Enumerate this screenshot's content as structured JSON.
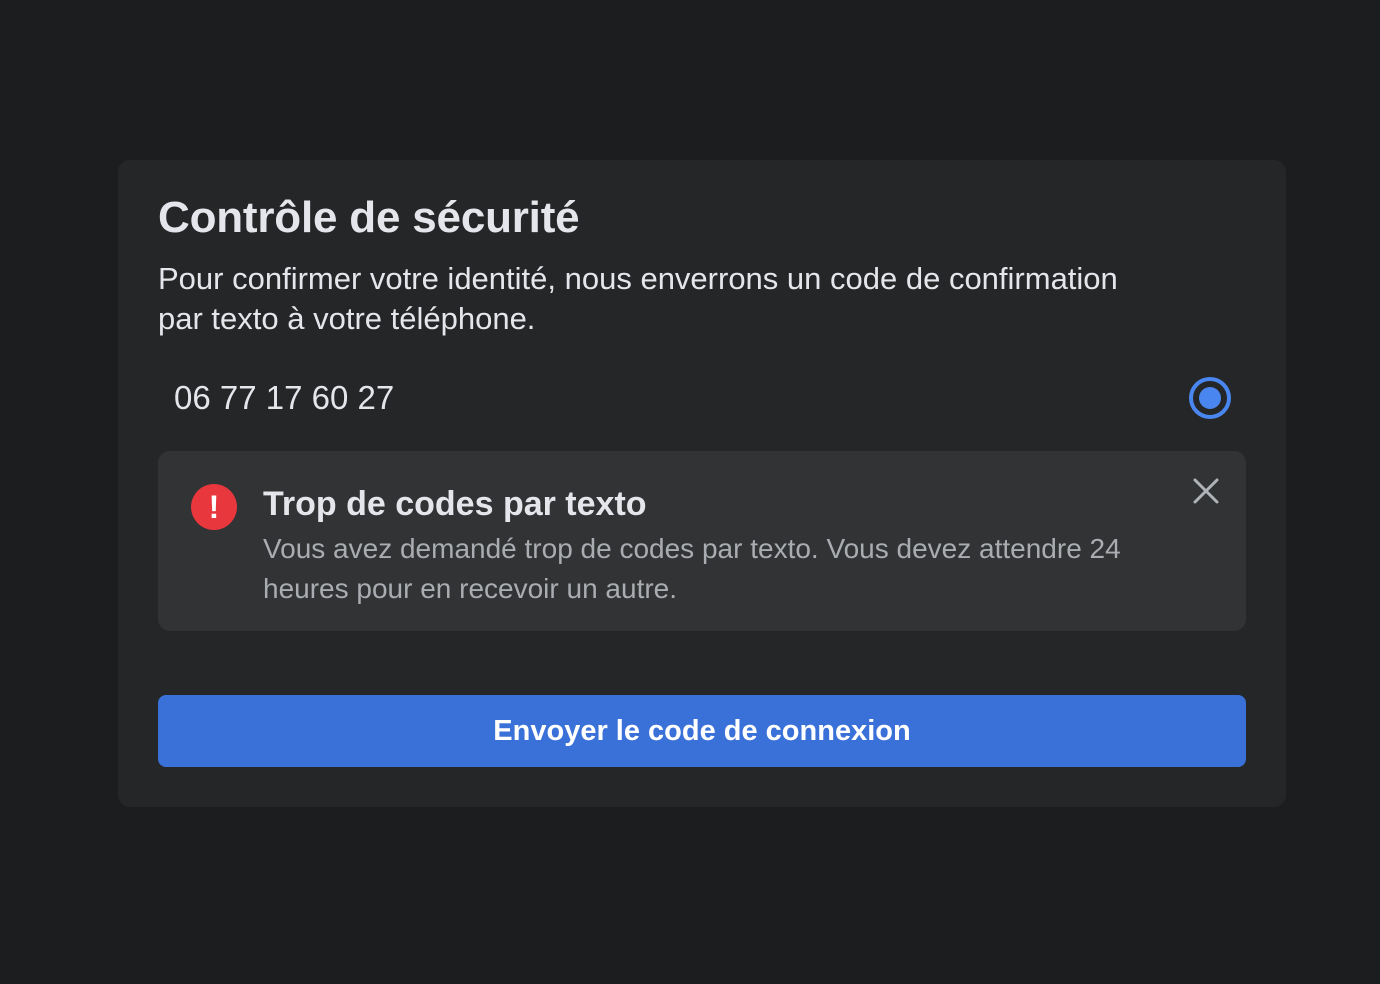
{
  "dialog": {
    "title": "Contrôle de sécurité",
    "description": "Pour confirmer votre identité, nous enverrons un code de confirmation par texto à votre téléphone."
  },
  "phone_option": {
    "number": "06 77 17 60 27",
    "selected": true
  },
  "alert": {
    "icon": "exclamation-icon",
    "icon_glyph": "!",
    "title": "Trop de codes par texto",
    "message": "Vous avez demandé trop de codes par texto. Vous devez attendre 24 heures pour en recevoir un autre.",
    "close_icon": "close-icon"
  },
  "actions": {
    "send_code_label": "Envoyer le code de connexion"
  },
  "colors": {
    "background": "#1c1d1f",
    "card": "#252628",
    "alert_background": "#323335",
    "accent": "#3a71d9",
    "radio": "#4a86f0",
    "error": "#e8383e"
  }
}
